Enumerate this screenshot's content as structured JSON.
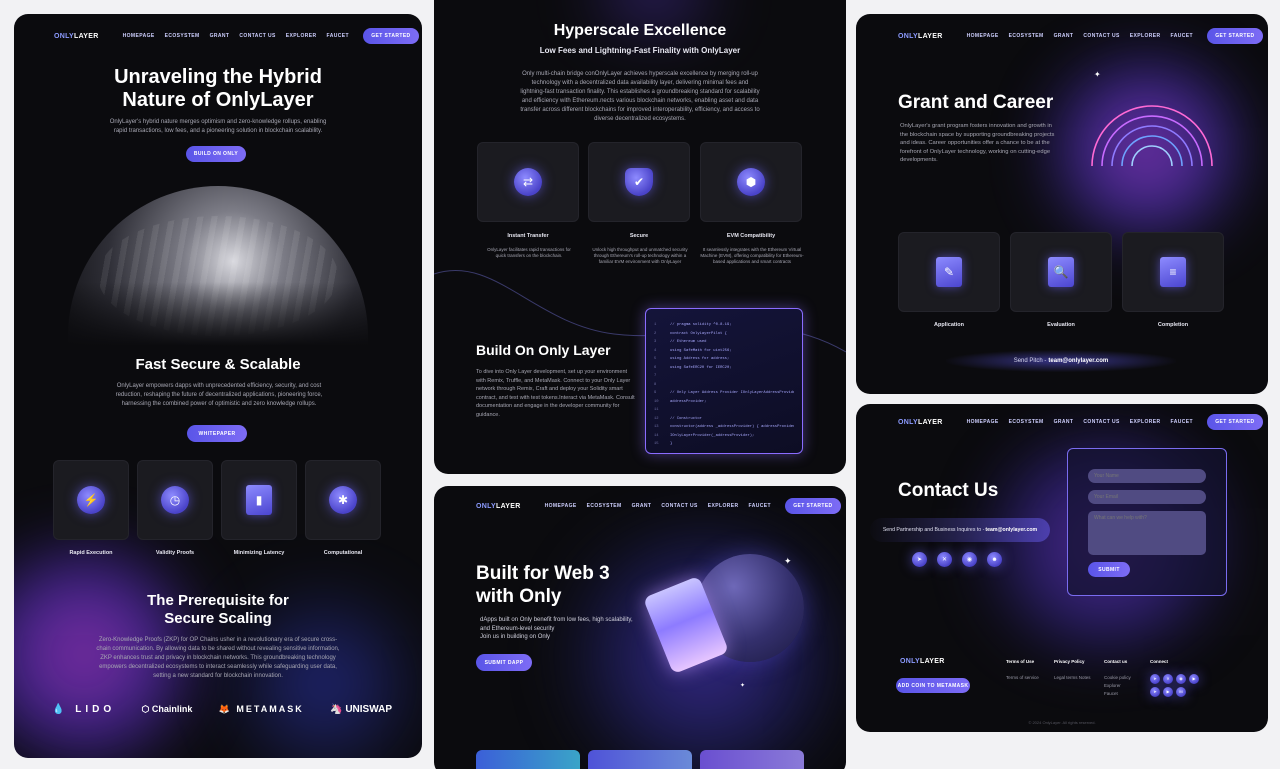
{
  "nav": {
    "logo_accent": "ONLY",
    "logo_rest": "LAYER",
    "links": [
      "HOMEPAGE",
      "ECOSYSTEM",
      "GRANT",
      "CONTACT US",
      "EXPLORER",
      "FAUCET"
    ],
    "cta": "GET STARTED"
  },
  "hero": {
    "title_line1": "Unraveling the Hybrid",
    "title_line2": "Nature of OnlyLayer",
    "desc": "OnlyLayer's hybrid nature merges optimism and zero-knowledge rollups, enabling rapid transactions, low fees, and a pioneering solution in blockchain scalability.",
    "button": "BUILD ON ONLY"
  },
  "fast": {
    "title": "Fast Secure & Scalable",
    "desc": "OnlyLayer empowers dapps with unprecedented efficiency, security, and cost reduction, reshaping the future of decentralized applications, pioneering force, harnessing the combined power of optimistic and zero knowledge rollups.",
    "button": "WHITEPAPER",
    "features": [
      "Rapid Execution",
      "Validity Proofs",
      "Minimizing Latency",
      "Computational"
    ]
  },
  "prereq": {
    "title_line1": "The Prerequisite for",
    "title_line2": "Secure Scaling",
    "desc": "Zero-Knowledge Proofs (ZKP) for OP Chains usher in a revolutionary era of secure cross-chain communication. By allowing data to be shared without revealing sensitive information, ZKP enhances trust and privacy in blockchain networks. This groundbreaking technology empowers decentralized ecosystems to interact seamlessly while safeguarding user data, setting a new standard for blockchain innovation.",
    "partners": [
      "LIDO",
      "Chainlink",
      "METAMASK",
      "UNISWAP"
    ]
  },
  "hyperscale": {
    "title": "Hyperscale Excellence",
    "subtitle": "Low Fees and Lightning-Fast Finality with OnlyLayer",
    "desc": "Only multi-chain bridge conOnlyLayer achieves hyperscale excellence by merging roll-up technology with a decentralized data availability layer, delivering minimal fees and lightning-fast transaction finality. This establishes a groundbreaking standard for scalability and efficiency with Ethereum.nects various blockchain networks, enabling asset and data transfer across different blockchains for improved interoperability, efficiency, and access to diverse decentralized ecosystems.",
    "cards": [
      {
        "title": "Instant Transfer",
        "desc": "OnlyLayer facilitates rapid transactions for quick transfers on the blockchain."
      },
      {
        "title": "Secure",
        "desc": "Unlock high throughput and unmatched security through Ethereum's roll-up technology within a familiar EVM environment with OnlyLayer"
      },
      {
        "title": "EVM Compatibility",
        "desc": "It seamlessly integrates with the Ethereum Virtual Machine (EVM), offering compatibility for Ethereum-based applications and smart contracts"
      }
    ]
  },
  "build": {
    "title": "Build On Only Layer",
    "desc": "To dive into Only Layer development, set up your environment with Remix, Truffle, and MetaMask. Connect to your Only Layer network through Remix, Craft and deploy your Solidity smart contract, and test with test tokens.Interact via MetaMask. Consult documentation and engage in the developer community for guidance.",
    "code": [
      "// pragma solidity ^0.8.19;",
      "contract OnlyLayerPilot {",
      "// Ethereum used",
      "using SafeMath for uint256;",
      "using Address for address;",
      "using SafeERC20 for IERC20;",
      "",
      "",
      "// Only Layer Address Provider    IOnlyLayerAddressProvider public",
      "addressProvider;",
      "",
      "// Constructor",
      "constructor(address _addressProvider) {     addressProvider =",
      "IOnlyLayerProvider(_addressProvider);",
      "}"
    ]
  },
  "web3": {
    "title_line1": "Built for Web 3",
    "title_line2": "with Only",
    "desc_line1": "dApps built on Only benefit from low fees, high scalability,",
    "desc_line2": "and Ethereum-level security",
    "desc_line3": "Join us in building on Only",
    "button": "SUBMIT DAPP"
  },
  "grant": {
    "title": "Grant and Career",
    "desc": "OnlyLayer's grant program fosters innovation and growth in the blockchain space by supporting groundbreaking projects and ideas. Career opportunities offer a chance to be at the forefront of OnlyLayer technology, working on cutting-edge developments.",
    "steps": [
      "Application",
      "Evaluation",
      "Completion"
    ],
    "pitch_prefix": "Send Pitch - ",
    "pitch_email": "team@onlylayer.com"
  },
  "contact": {
    "title": "Contact Us",
    "inquiry_prefix": "Send Partnership and Business Inquires to - ",
    "inquiry_email": "team@onlylayer.com",
    "name_placeholder": "Your Name",
    "email_placeholder": "Your Email",
    "message_placeholder": "What can we help with?",
    "submit": "SUBMIT"
  },
  "footer": {
    "metamask_button": "ADD COIN TO METAMASK",
    "terms_heading": "Terms of Use",
    "terms_link": "Terms of service",
    "privacy_heading": "Privacy Policy",
    "privacy_link": "Legal terms Notes",
    "contact_heading": "Contact us",
    "contact_links": [
      "Cookie policy",
      "Explorer",
      "Faucet"
    ],
    "connect_heading": "Connect",
    "copyright": "© 2024 OnlyLayer. All rights reserved."
  },
  "colors": {
    "accent": "#6a5ff0",
    "background": "#0b0b0e",
    "card": "#1b1b20"
  }
}
